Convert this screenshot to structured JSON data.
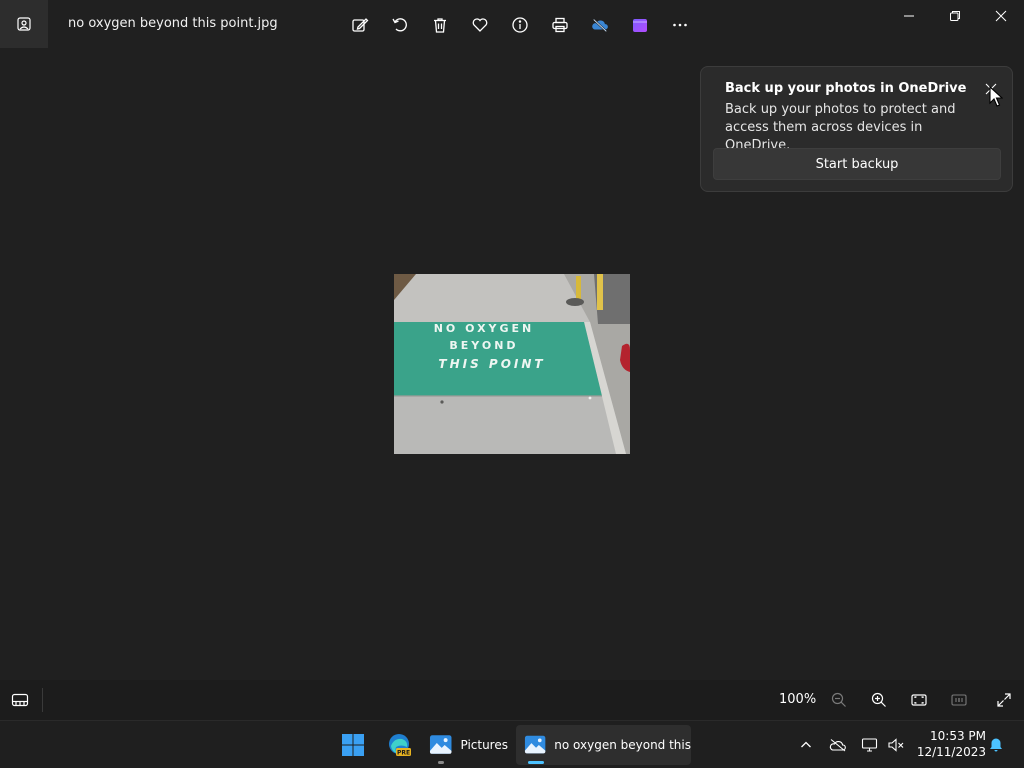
{
  "window": {
    "file_name": "no oxygen beyond this point.jpg",
    "toolbar_icons": [
      "edit-icon",
      "rotate-icon",
      "delete-icon",
      "favorite-icon",
      "info-icon",
      "print-icon",
      "onedrive-icon",
      "clipchamp-icon",
      "more-icon"
    ],
    "controls": [
      "minimize-icon",
      "restore-icon",
      "close-icon"
    ]
  },
  "photo": {
    "sign_lines": [
      "NO OXYGEN",
      "BEYOND",
      "THIS POINT"
    ]
  },
  "popup": {
    "title": "Back up your photos in OneDrive",
    "body": "Back up your photos to protect and access them across devices in OneDrive.",
    "button_label": "Start backup"
  },
  "bottom_bar": {
    "zoom": "100%"
  },
  "taskbar": {
    "pictures_label": "Pictures",
    "photos_label": "no oxygen beyond this",
    "edge_badge": "PRE",
    "time": "10:53 PM",
    "date": "12/11/2023"
  },
  "colors": {
    "background": "#202020",
    "accent": "#4cc2ff",
    "sign_green": "#3aa38a"
  }
}
